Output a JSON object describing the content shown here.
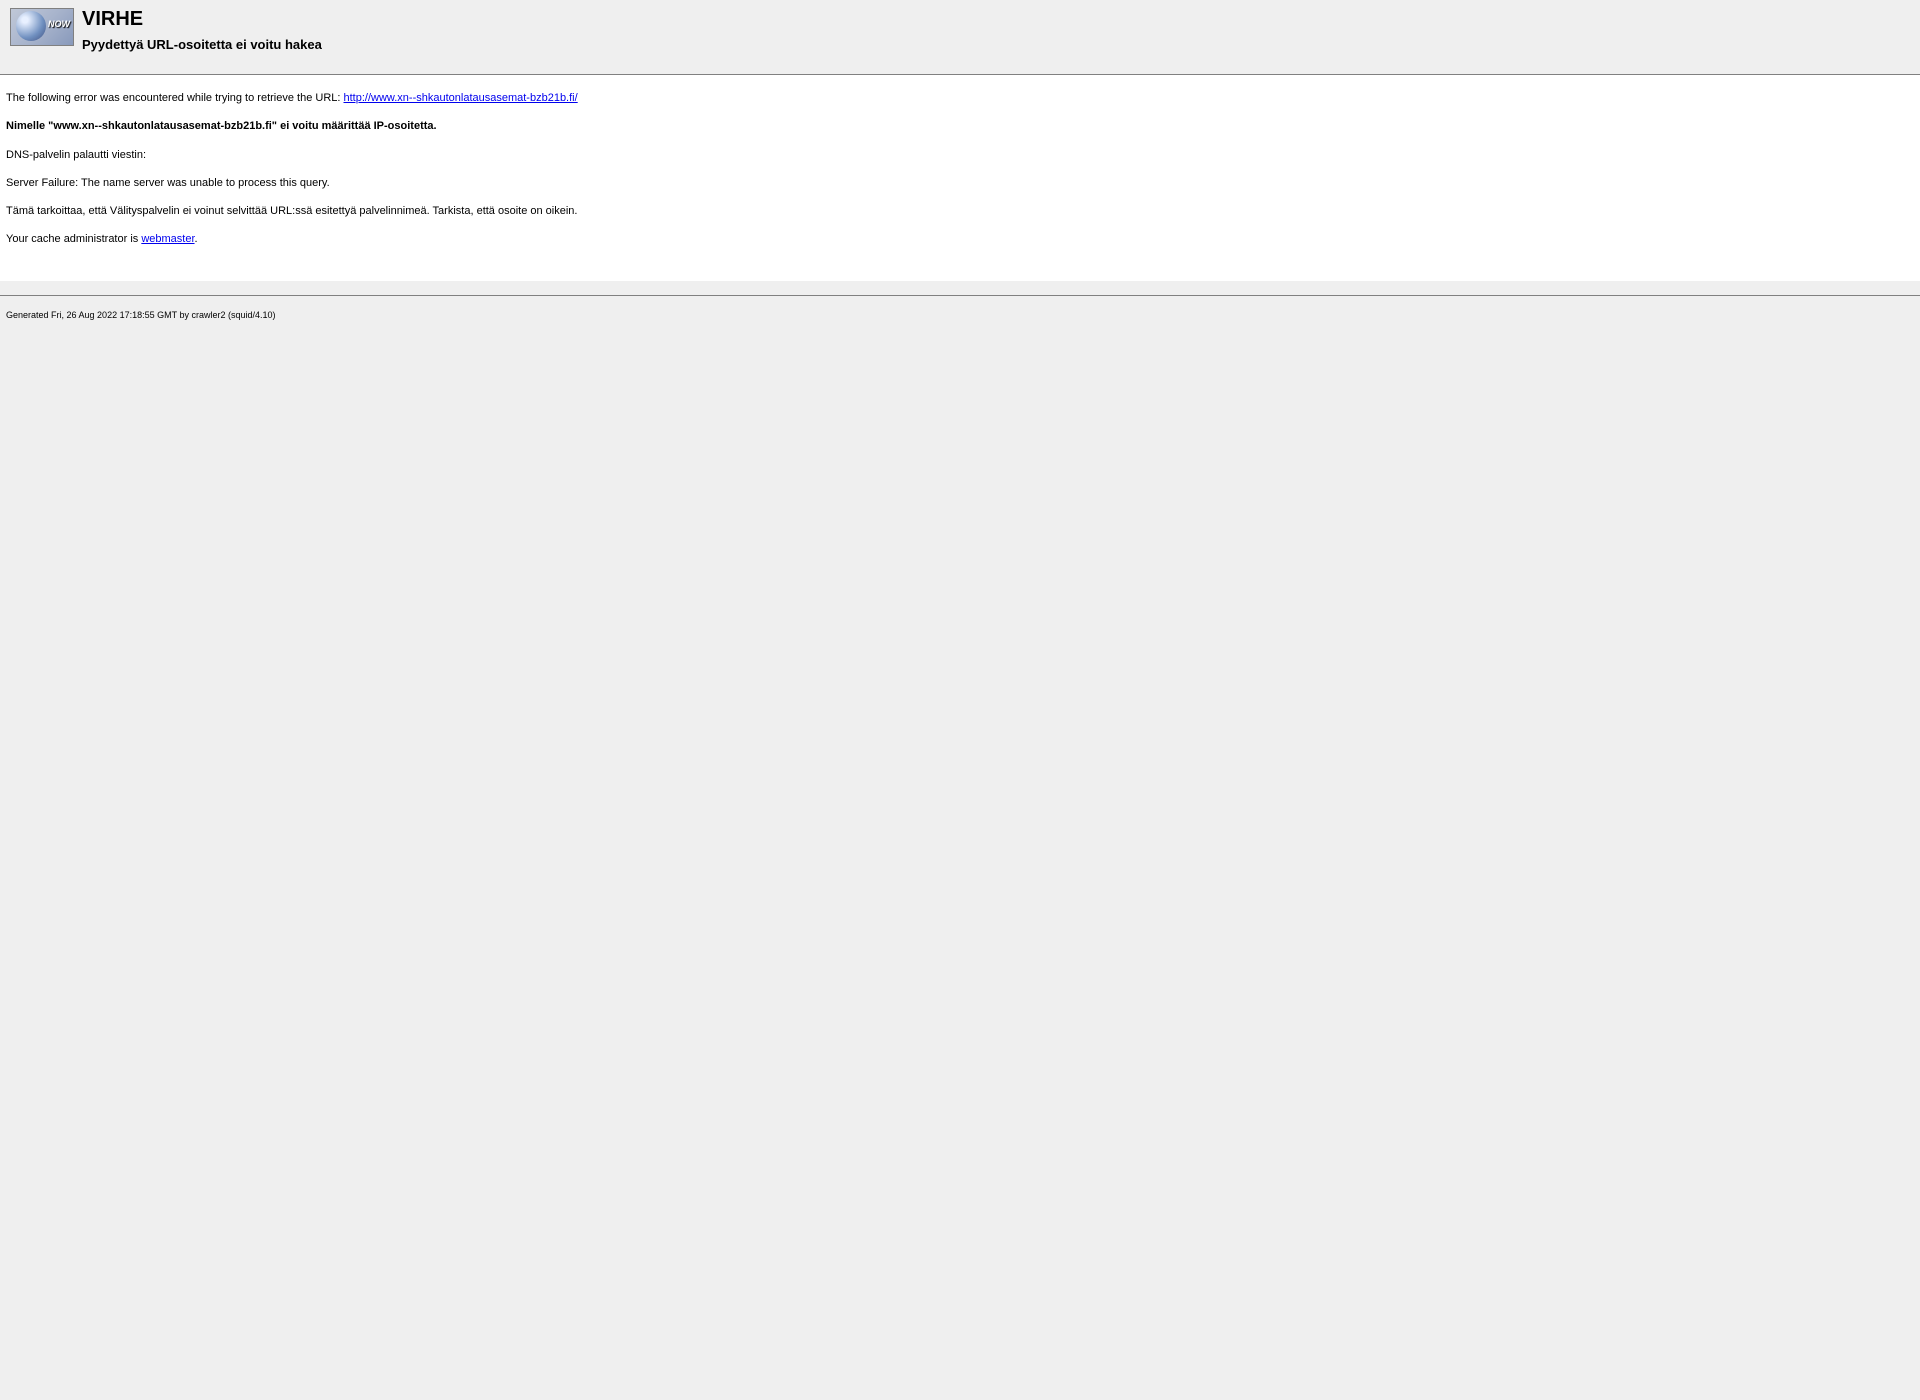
{
  "header": {
    "logo_text": "NOW",
    "title": "VIRHE",
    "subtitle": "Pyydettyä URL-osoitetta ei voitu hakea"
  },
  "content": {
    "error_intro": "The following error was encountered while trying to retrieve the URL: ",
    "error_url": "http://www.xn--shkautonlatausasemat-bzb21b.fi/",
    "dns_error": "Nimelle \"www.xn--shkautonlatausasemat-bzb21b.fi\" ei voitu määrittää IP-osoitetta.",
    "dns_server_label": "DNS-palvelin palautti viestin:",
    "dns_server_message": "Server Failure: The name server was unable to process this query.",
    "explanation": "Tämä tarkoittaa, että Välityspalvelin ei voinut selvittää URL:ssä esitettyä palvelinnimeä. Tarkista, että osoite on oikein.",
    "admin_prefix": "Your cache administrator is ",
    "admin_link": "webmaster",
    "admin_suffix": "."
  },
  "footer": {
    "generated": "Generated Fri, 26 Aug 2022 17:18:55 GMT by crawler2 (squid/4.10)"
  }
}
